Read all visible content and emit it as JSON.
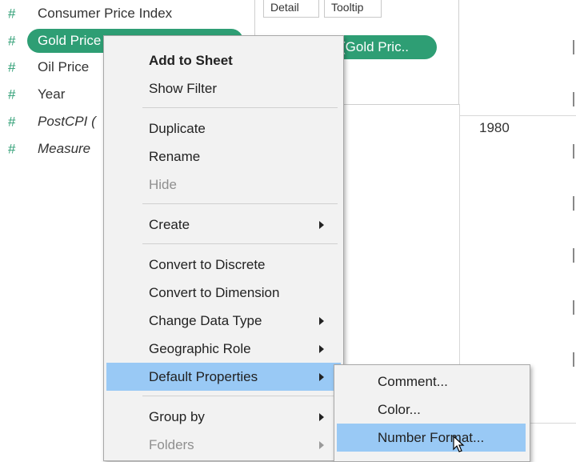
{
  "data_pane": {
    "fields": [
      {
        "label": "Consumer Price Index",
        "icon": "hash-icon",
        "italic": false
      },
      {
        "label": "Gold Price",
        "icon": "hash-icon",
        "italic": false,
        "selected": true
      },
      {
        "label": "Oil Price",
        "icon": "hash-icon",
        "italic": false
      },
      {
        "label": "Year",
        "icon": "hash-icon",
        "italic": false
      },
      {
        "label": "PostCPI (",
        "icon": "hash-icon",
        "italic": true
      },
      {
        "label": "Measure",
        "icon": "hash-icon",
        "italic": true
      }
    ],
    "hash_symbol": "#"
  },
  "marks_card": {
    "detail_label": "Detail",
    "tooltip_label": "Tooltip",
    "pill_label": "(Gold Pric.."
  },
  "view": {
    "year_header": "1980"
  },
  "context_menu": {
    "items": [
      {
        "label": "Add to Sheet",
        "bold": true
      },
      {
        "label": "Show Filter"
      },
      {
        "label": "Duplicate"
      },
      {
        "label": "Rename"
      },
      {
        "label": "Hide",
        "disabled": true
      },
      {
        "label": "Create",
        "submenu": true
      },
      {
        "label": "Convert to Discrete"
      },
      {
        "label": "Convert to Dimension"
      },
      {
        "label": "Change Data Type",
        "submenu": true
      },
      {
        "label": "Geographic Role",
        "submenu": true
      },
      {
        "label": "Default Properties",
        "submenu": true,
        "active": true
      },
      {
        "label": "Group by",
        "submenu": true
      },
      {
        "label": "Folders",
        "submenu": true,
        "disabled": true
      }
    ]
  },
  "default_properties_submenu": {
    "items": [
      {
        "label": "Comment..."
      },
      {
        "label": "Color..."
      },
      {
        "label": "Number Format...",
        "active": true
      }
    ]
  },
  "colors": {
    "pill_green": "#2e9e74",
    "menu_highlight": "#99c9f5",
    "menu_bg": "#f2f2f2"
  }
}
